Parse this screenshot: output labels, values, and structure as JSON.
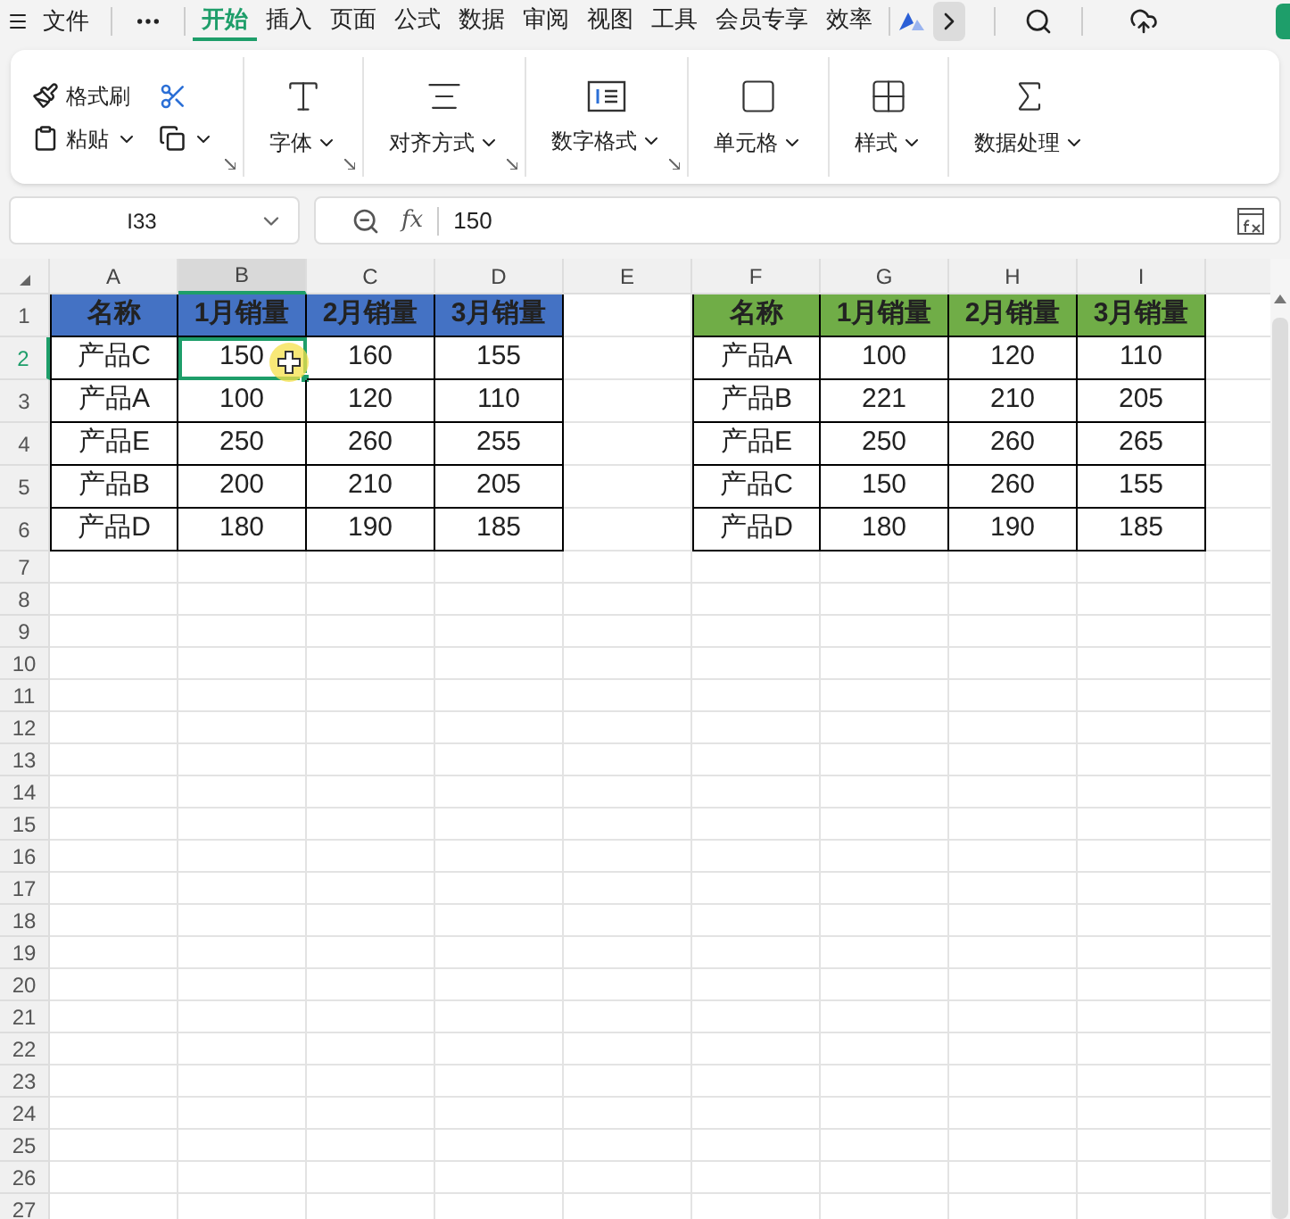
{
  "menu_bar": {
    "file": "文件",
    "tabs": [
      {
        "label": "开始",
        "selected": true
      },
      {
        "label": "插入",
        "selected": false
      },
      {
        "label": "页面",
        "selected": false
      },
      {
        "label": "公式",
        "selected": false
      },
      {
        "label": "数据",
        "selected": false
      },
      {
        "label": "审阅",
        "selected": false
      },
      {
        "label": "视图",
        "selected": false
      },
      {
        "label": "工具",
        "selected": false
      },
      {
        "label": "会员专享",
        "selected": false
      },
      {
        "label": "效率",
        "selected": false
      }
    ]
  },
  "ribbon": {
    "format_painter": "格式刷",
    "paste": "粘贴",
    "groups": [
      {
        "kind": "font",
        "label": "字体"
      },
      {
        "kind": "align",
        "label": "对齐方式"
      },
      {
        "kind": "number",
        "label": "数字格式"
      },
      {
        "kind": "cell",
        "label": "单元格"
      },
      {
        "kind": "style",
        "label": "样式"
      },
      {
        "kind": "sum",
        "label": "数据处理"
      }
    ]
  },
  "formula_bar": {
    "name_box": "I33",
    "fx": "fx",
    "value": "150"
  },
  "column_headers": [
    {
      "label": "A",
      "selected": false
    },
    {
      "label": "B",
      "selected": true
    },
    {
      "label": "C",
      "selected": false
    },
    {
      "label": "D",
      "selected": false
    },
    {
      "label": "E",
      "selected": false
    },
    {
      "label": "F",
      "selected": false
    },
    {
      "label": "G",
      "selected": false
    },
    {
      "label": "H",
      "selected": false
    },
    {
      "label": "I",
      "selected": false
    }
  ],
  "row_headers": [
    {
      "label": "1",
      "selected": false
    },
    {
      "label": "2",
      "selected": true
    },
    {
      "label": "3",
      "selected": false
    },
    {
      "label": "4",
      "selected": false
    },
    {
      "label": "5",
      "selected": false
    },
    {
      "label": "6",
      "selected": false
    },
    {
      "label": "7",
      "selected": false
    },
    {
      "label": "8",
      "selected": false
    },
    {
      "label": "9",
      "selected": false
    },
    {
      "label": "10",
      "selected": false
    },
    {
      "label": "11",
      "selected": false
    },
    {
      "label": "12",
      "selected": false
    },
    {
      "label": "13",
      "selected": false
    },
    {
      "label": "14",
      "selected": false
    },
    {
      "label": "15",
      "selected": false
    },
    {
      "label": "16",
      "selected": false
    },
    {
      "label": "17",
      "selected": false
    },
    {
      "label": "18",
      "selected": false
    },
    {
      "label": "19",
      "selected": false
    },
    {
      "label": "20",
      "selected": false
    },
    {
      "label": "21",
      "selected": false
    },
    {
      "label": "22",
      "selected": false
    },
    {
      "label": "23",
      "selected": false
    },
    {
      "label": "24",
      "selected": false
    },
    {
      "label": "25",
      "selected": false
    },
    {
      "label": "26",
      "selected": false
    },
    {
      "label": "27",
      "selected": false
    }
  ],
  "tables": [
    {
      "color": "#4472c4",
      "columns": [
        "名称",
        "1月销量",
        "2月销量",
        "3月销量"
      ],
      "rows": [
        {
          "cells": [
            {
              "text": "产品C",
              "selected": false
            },
            {
              "text": "150",
              "selected": true
            },
            {
              "text": "160",
              "selected": false
            },
            {
              "text": "155",
              "selected": false
            }
          ]
        },
        {
          "cells": [
            {
              "text": "产品A",
              "selected": false
            },
            {
              "text": "100",
              "selected": false
            },
            {
              "text": "120",
              "selected": false
            },
            {
              "text": "110",
              "selected": false
            }
          ]
        },
        {
          "cells": [
            {
              "text": "产品E",
              "selected": false
            },
            {
              "text": "250",
              "selected": false
            },
            {
              "text": "260",
              "selected": false
            },
            {
              "text": "255",
              "selected": false
            }
          ]
        },
        {
          "cells": [
            {
              "text": "产品B",
              "selected": false
            },
            {
              "text": "200",
              "selected": false
            },
            {
              "text": "210",
              "selected": false
            },
            {
              "text": "205",
              "selected": false
            }
          ]
        },
        {
          "cells": [
            {
              "text": "产品D",
              "selected": false
            },
            {
              "text": "180",
              "selected": false
            },
            {
              "text": "190",
              "selected": false
            },
            {
              "text": "185",
              "selected": false
            }
          ]
        }
      ]
    },
    {
      "color": "#70ad47",
      "columns": [
        "名称",
        "1月销量",
        "2月销量",
        "3月销量"
      ],
      "rows": [
        {
          "cells": [
            {
              "text": "产品A",
              "selected": false
            },
            {
              "text": "100",
              "selected": false
            },
            {
              "text": "120",
              "selected": false
            },
            {
              "text": "110",
              "selected": false
            }
          ]
        },
        {
          "cells": [
            {
              "text": "产品B",
              "selected": false
            },
            {
              "text": "221",
              "selected": false
            },
            {
              "text": "210",
              "selected": false
            },
            {
              "text": "205",
              "selected": false
            }
          ]
        },
        {
          "cells": [
            {
              "text": "产品E",
              "selected": false
            },
            {
              "text": "250",
              "selected": false
            },
            {
              "text": "260",
              "selected": false
            },
            {
              "text": "265",
              "selected": false
            }
          ]
        },
        {
          "cells": [
            {
              "text": "产品C",
              "selected": false
            },
            {
              "text": "150",
              "selected": false
            },
            {
              "text": "260",
              "selected": false
            },
            {
              "text": "155",
              "selected": false
            }
          ]
        },
        {
          "cells": [
            {
              "text": "产品D",
              "selected": false
            },
            {
              "text": "180",
              "selected": false
            },
            {
              "text": "190",
              "selected": false
            },
            {
              "text": "185",
              "selected": false
            }
          ]
        }
      ]
    }
  ]
}
